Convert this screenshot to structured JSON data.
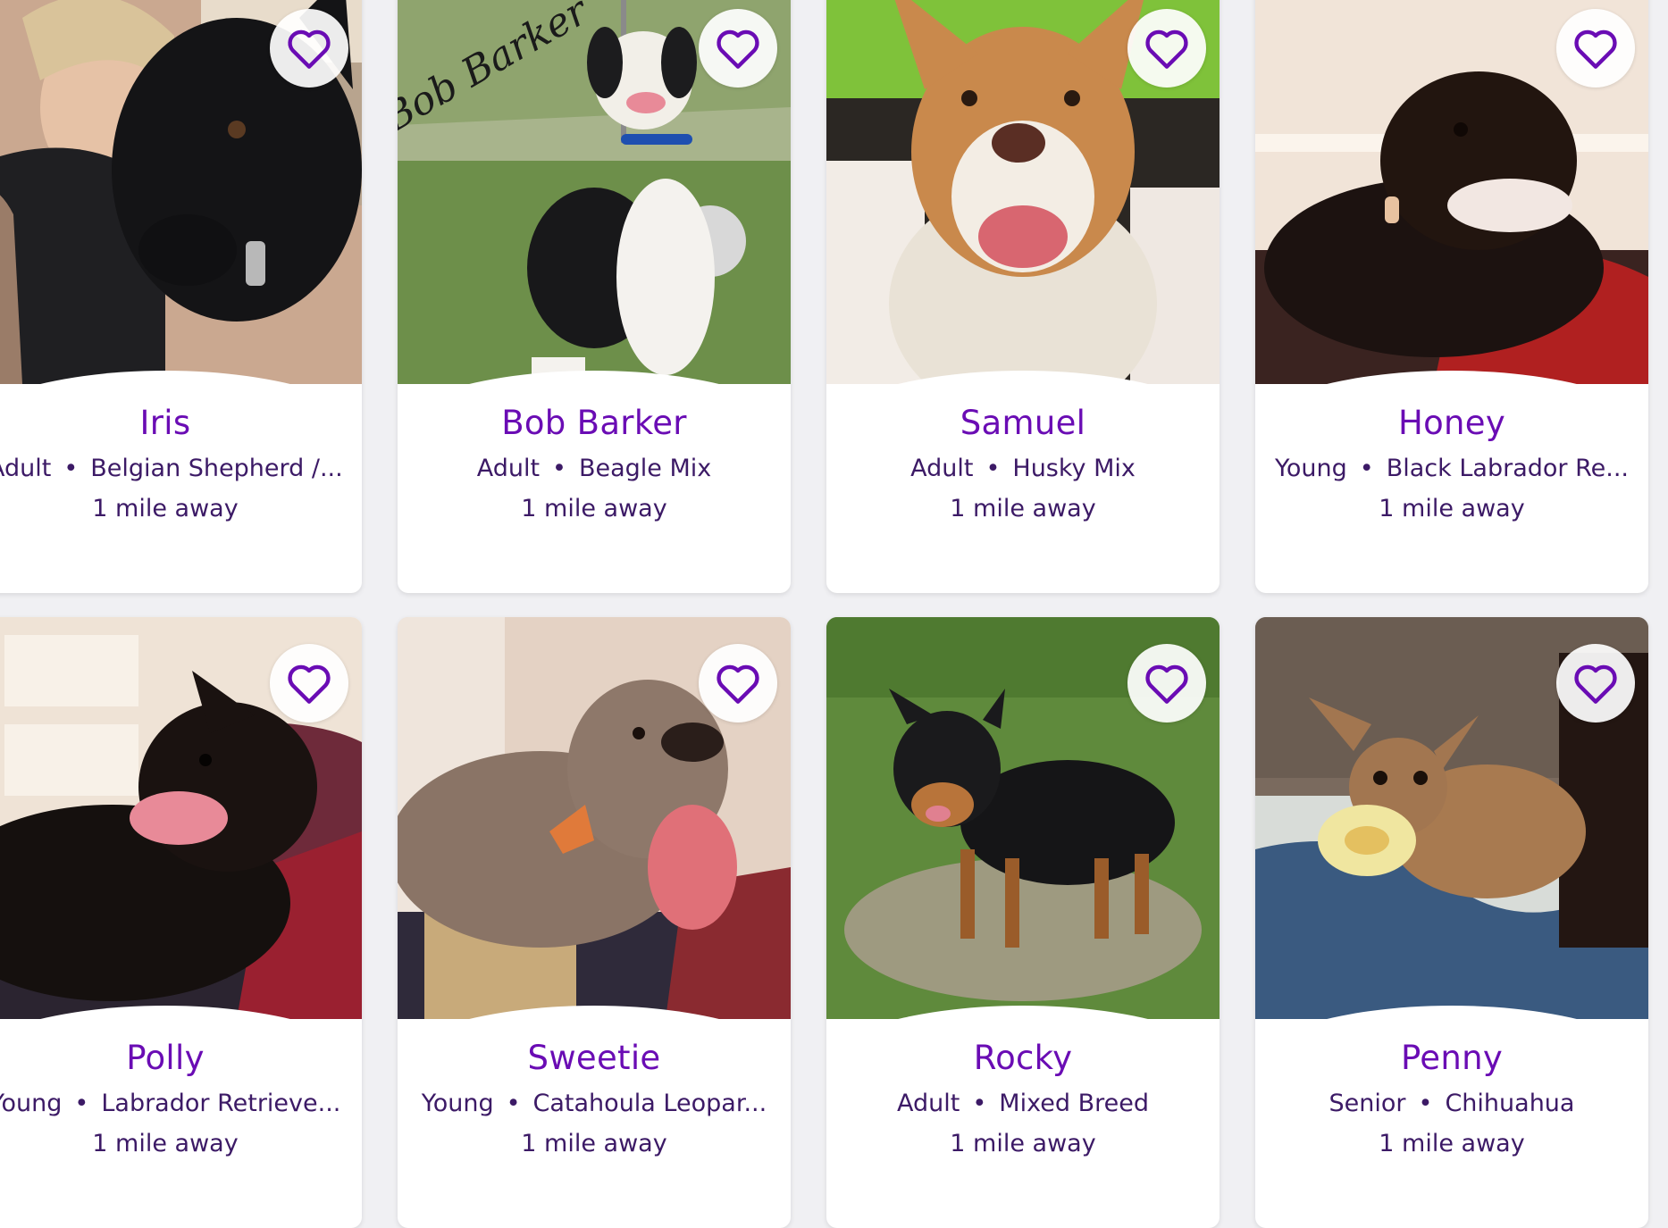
{
  "favorite_icon": "heart-outline-icon",
  "accent_color": "#6a0cb4",
  "pets": [
    {
      "name": "Iris",
      "age": "Adult",
      "breed": "Belgian Shepherd /...",
      "distance": "1 mile away",
      "photo_text": ""
    },
    {
      "name": "Bob Barker",
      "age": "Adult",
      "breed": "Beagle Mix",
      "distance": "1 mile away",
      "photo_text": "Bob Barker"
    },
    {
      "name": "Samuel",
      "age": "Adult",
      "breed": "Husky Mix",
      "distance": "1 mile away",
      "photo_text": ""
    },
    {
      "name": "Honey",
      "age": "Young",
      "breed": "Black Labrador Re...",
      "distance": "1 mile away",
      "photo_text": ""
    },
    {
      "name": "Polly",
      "age": "Young",
      "breed": "Labrador Retrieve...",
      "distance": "1 mile away",
      "photo_text": ""
    },
    {
      "name": "Sweetie",
      "age": "Young",
      "breed": "Catahoula Leopar...",
      "distance": "1 mile away",
      "photo_text": ""
    },
    {
      "name": "Rocky",
      "age": "Adult",
      "breed": "Mixed Breed",
      "distance": "1 mile away",
      "photo_text": ""
    },
    {
      "name": "Penny",
      "age": "Senior",
      "breed": "Chihuahua",
      "distance": "1 mile away",
      "photo_text": ""
    }
  ]
}
